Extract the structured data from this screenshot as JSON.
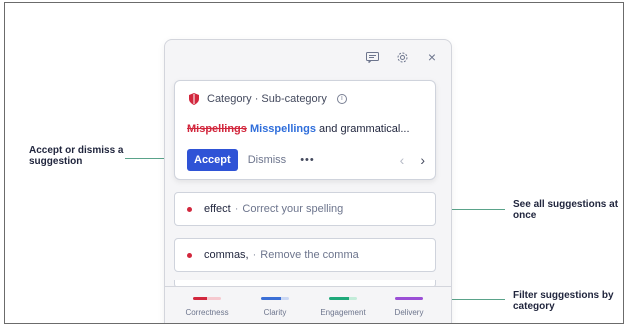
{
  "panel": {
    "toolbar": {
      "feedback_icon": "feedback-icon",
      "settings_icon": "gear-icon",
      "close_icon": "close-icon",
      "close_glyph": "×"
    },
    "main_card": {
      "category": "Category · Sub-category",
      "info_glyph": "i",
      "misspelled": "Mispellings",
      "correction": "Misspellings",
      "rest": " and grammatical...",
      "accept_label": "Accept",
      "dismiss_label": "Dismiss",
      "more_label": "•••",
      "prev_glyph": "‹",
      "next_glyph": "›"
    },
    "suggestions": [
      {
        "word": "effect",
        "sep": "·",
        "description": "Correct your spelling"
      },
      {
        "word": "commas,",
        "sep": "·",
        "description": "Remove the comma"
      }
    ],
    "categories": [
      {
        "label": "Correctness",
        "color": "#d2273d"
      },
      {
        "label": "Clarity",
        "color": "#3b6fd6"
      },
      {
        "label": "Engagement",
        "color": "#1fa97a"
      },
      {
        "label": "Delivery",
        "color": "#9b4fd6"
      }
    ]
  },
  "callouts": {
    "accept": "Accept or dismiss a suggestion",
    "see_all": "See all suggestions at once",
    "filter": "Filter suggestions by category"
  },
  "colors": {
    "accent": "#2f53d6",
    "error": "#d2273d",
    "callout_line": "#5aa38a"
  }
}
